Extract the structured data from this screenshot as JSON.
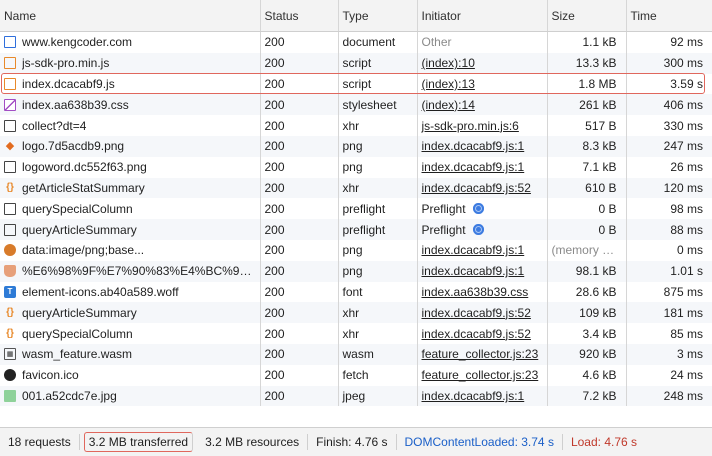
{
  "columns": {
    "name": "Name",
    "status": "Status",
    "type": "Type",
    "initiator": "Initiator",
    "size": "Size",
    "time": "Time"
  },
  "rows": [
    {
      "name": "www.kengcoder.com",
      "icon": "document-icon",
      "status": "200",
      "type": "document",
      "initiator": "Other",
      "initiator_style": "other",
      "globe": false,
      "size": "1.1 kB",
      "time": "92 ms"
    },
    {
      "name": "js-sdk-pro.min.js",
      "icon": "script-icon",
      "status": "200",
      "type": "script",
      "initiator": "(index):10",
      "initiator_style": "link",
      "globe": false,
      "size": "13.3 kB",
      "time": "300 ms"
    },
    {
      "name": "index.dcacabf9.js",
      "icon": "script-icon",
      "status": "200",
      "type": "script",
      "initiator": "(index):13",
      "initiator_style": "link",
      "globe": false,
      "size": "1.8 MB",
      "time": "3.59 s",
      "highlighted": true
    },
    {
      "name": "index.aa638b39.css",
      "icon": "stylesheet-icon",
      "status": "200",
      "type": "stylesheet",
      "initiator": "(index):14",
      "initiator_style": "link",
      "globe": false,
      "size": "261 kB",
      "time": "406 ms"
    },
    {
      "name": "collect?dt=4",
      "icon": "blank-file-icon",
      "status": "200",
      "type": "xhr",
      "initiator": "js-sdk-pro.min.js:6",
      "initiator_style": "link",
      "globe": false,
      "size": "517 B",
      "time": "330 ms"
    },
    {
      "name": "logo.7d5acdb9.png",
      "icon": "logo-image-icon",
      "status": "200",
      "type": "png",
      "initiator": "index.dcacabf9.js:1",
      "initiator_style": "link",
      "globe": false,
      "size": "8.3 kB",
      "time": "247 ms"
    },
    {
      "name": "logoword.dc552f63.png",
      "icon": "blank-file-icon",
      "status": "200",
      "type": "png",
      "initiator": "index.dcacabf9.js:1",
      "initiator_style": "link",
      "globe": false,
      "size": "7.1 kB",
      "time": "26 ms"
    },
    {
      "name": "getArticleStatSummary",
      "icon": "xhr-icon",
      "status": "200",
      "type": "xhr",
      "initiator": "index.dcacabf9.js:52",
      "initiator_style": "link",
      "globe": false,
      "size": "610 B",
      "time": "120 ms"
    },
    {
      "name": "querySpecialColumn",
      "icon": "blank-file-icon",
      "status": "200",
      "type": "preflight",
      "initiator": "Preflight",
      "initiator_style": "plain",
      "globe": true,
      "size": "0 B",
      "time": "98 ms"
    },
    {
      "name": "queryArticleSummary",
      "icon": "blank-file-icon",
      "status": "200",
      "type": "preflight",
      "initiator": "Preflight",
      "initiator_style": "plain",
      "globe": true,
      "size": "0 B",
      "time": "88 ms"
    },
    {
      "name": "data:image/png;base...",
      "icon": "emoji-image-icon",
      "status": "200",
      "type": "png",
      "initiator": "index.dcacabf9.js:1",
      "initiator_style": "link",
      "globe": false,
      "size": "(memory c...",
      "size_style": "muted",
      "time": "0 ms"
    },
    {
      "name": "%E6%98%9F%E7%90%83%E4%BC%98%E...",
      "icon": "cup-image-icon",
      "status": "200",
      "type": "png",
      "initiator": "index.dcacabf9.js:1",
      "initiator_style": "link",
      "globe": false,
      "size": "98.1 kB",
      "time": "1.01 s"
    },
    {
      "name": "element-icons.ab40a589.woff",
      "icon": "font-icon",
      "status": "200",
      "type": "font",
      "initiator": "index.aa638b39.css",
      "initiator_style": "link",
      "globe": false,
      "size": "28.6 kB",
      "time": "875 ms"
    },
    {
      "name": "queryArticleSummary",
      "icon": "xhr-icon",
      "status": "200",
      "type": "xhr",
      "initiator": "index.dcacabf9.js:52",
      "initiator_style": "link",
      "globe": false,
      "size": "109 kB",
      "time": "181 ms"
    },
    {
      "name": "querySpecialColumn",
      "icon": "xhr-icon",
      "status": "200",
      "type": "xhr",
      "initiator": "index.dcacabf9.js:52",
      "initiator_style": "link",
      "globe": false,
      "size": "3.4 kB",
      "time": "85 ms"
    },
    {
      "name": "wasm_feature.wasm",
      "icon": "wasm-icon",
      "status": "200",
      "type": "wasm",
      "initiator": "feature_collector.js:23",
      "initiator_style": "link",
      "globe": false,
      "size": "920 kB",
      "time": "3 ms"
    },
    {
      "name": "favicon.ico",
      "icon": "favicon-icon",
      "status": "200",
      "type": "fetch",
      "initiator": "feature_collector.js:23",
      "initiator_style": "link",
      "globe": false,
      "size": "4.6 kB",
      "time": "24 ms"
    },
    {
      "name": "001.a52cdc7e.jpg",
      "icon": "jpeg-image-icon",
      "status": "200",
      "type": "jpeg",
      "initiator": "index.dcacabf9.js:1",
      "initiator_style": "link",
      "globe": false,
      "size": "7.2 kB",
      "time": "248 ms"
    }
  ],
  "summary": {
    "requests": "18 requests",
    "transferred": "3.2 MB transferred",
    "resources": "3.2 MB resources",
    "finish": "Finish: 4.76 s",
    "dom_content_loaded": "DOMContentLoaded: 3.74 s",
    "load": "Load: 4.76 s"
  },
  "colors": {
    "highlight_border": "#e0675d",
    "dom_content_loaded": "#1a5fc8",
    "load": "#c0392b"
  }
}
